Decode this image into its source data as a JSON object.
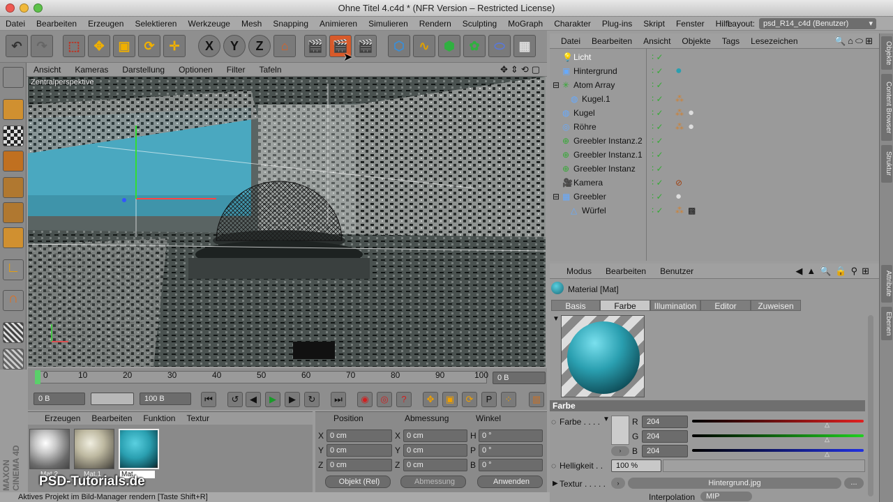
{
  "window": {
    "title": "Ohne Titel 4.c4d * (NFR Version – Restricted License)"
  },
  "menu": [
    "Datei",
    "Bearbeiten",
    "Erzeugen",
    "Selektieren",
    "Werkzeuge",
    "Mesh",
    "Snapping",
    "Animieren",
    "Simulieren",
    "Rendern",
    "Sculpting",
    "MoGraph",
    "Charakter",
    "Plug-ins",
    "Skript",
    "Fenster",
    "Hilfe"
  ],
  "layout": {
    "label": "Layout:",
    "value": "psd_R14_c4d (Benutzer)"
  },
  "toolbar": {
    "x_label": "X",
    "y_label": "Y",
    "z_label": "Z"
  },
  "viewport": {
    "menu": [
      "Ansicht",
      "Kameras",
      "Darstellung",
      "Optionen",
      "Filter",
      "Tafeln"
    ],
    "label": "Zentralperspektive"
  },
  "timeline": {
    "ticks": [
      "0",
      "10",
      "20",
      "30",
      "40",
      "50",
      "60",
      "70",
      "80",
      "90",
      "100"
    ],
    "current": "0 B"
  },
  "transport": {
    "start": "0 B",
    "end": "100 B"
  },
  "materials": {
    "menu": [
      "Erzeugen",
      "Bearbeiten",
      "Funktion",
      "Textur"
    ],
    "items": [
      {
        "name": "Mat.2"
      },
      {
        "name": "Mat.1"
      },
      {
        "name": "Mat"
      }
    ]
  },
  "coords": {
    "headers": [
      "Position",
      "Abmessung",
      "Winkel"
    ],
    "rows": [
      {
        "a": "X",
        "av": "0 cm",
        "b": "X",
        "bv": "0 cm",
        "c": "H",
        "cv": "0 °"
      },
      {
        "a": "Y",
        "av": "0 cm",
        "b": "Y",
        "bv": "0 cm",
        "c": "P",
        "cv": "0 °"
      },
      {
        "a": "Z",
        "av": "0 cm",
        "b": "Z",
        "bv": "0 cm",
        "c": "B",
        "cv": "0 °"
      }
    ],
    "mode": "Objekt (Rel)",
    "size_mode": "Abmessung",
    "apply": "Anwenden"
  },
  "objects": {
    "menu": [
      "Datei",
      "Bearbeiten",
      "Ansicht",
      "Objekte",
      "Tags",
      "Lesezeichen"
    ],
    "items": [
      {
        "name": "Licht"
      },
      {
        "name": "Hintergrund"
      },
      {
        "name": "Atom Array"
      },
      {
        "name": "Kugel.1"
      },
      {
        "name": "Kugel"
      },
      {
        "name": "Röhre"
      },
      {
        "name": "Greebler Instanz.2"
      },
      {
        "name": "Greebler Instanz.1"
      },
      {
        "name": "Greebler Instanz"
      },
      {
        "name": "Kamera"
      },
      {
        "name": "Greebler"
      },
      {
        "name": "Würfel"
      }
    ]
  },
  "attributes": {
    "menu": [
      "Modus",
      "Bearbeiten",
      "Benutzer"
    ],
    "title": "Material [Mat]",
    "tabs": [
      "Basis",
      "Farbe",
      "Illumination",
      "Editor",
      "Zuweisen"
    ],
    "section": "Farbe",
    "color_label": "Farbe . . . .",
    "r_label": "R",
    "r": "204",
    "g_label": "G",
    "g": "204",
    "b_label": "B",
    "b": "204",
    "brightness_label": "Helligkeit . .",
    "brightness": "100 %",
    "texture_label": "Textur . . . . .",
    "texture": "Hintergrund.jpg",
    "texture_more": "...",
    "interp_label": "Interpolation",
    "interp": "MIP"
  },
  "siderail": [
    "Objekte",
    "Content Browser",
    "Struktur",
    "Attribute",
    "Ebenen"
  ],
  "status": "Aktives Projekt im Bild-Manager rendern [Taste Shift+R]",
  "watermark": "PSD-Tutorials.de",
  "brand": "MAXON CINEMA 4D",
  "colors": {
    "accent": "#2a9fb0",
    "render_active": "#d85a2a"
  }
}
